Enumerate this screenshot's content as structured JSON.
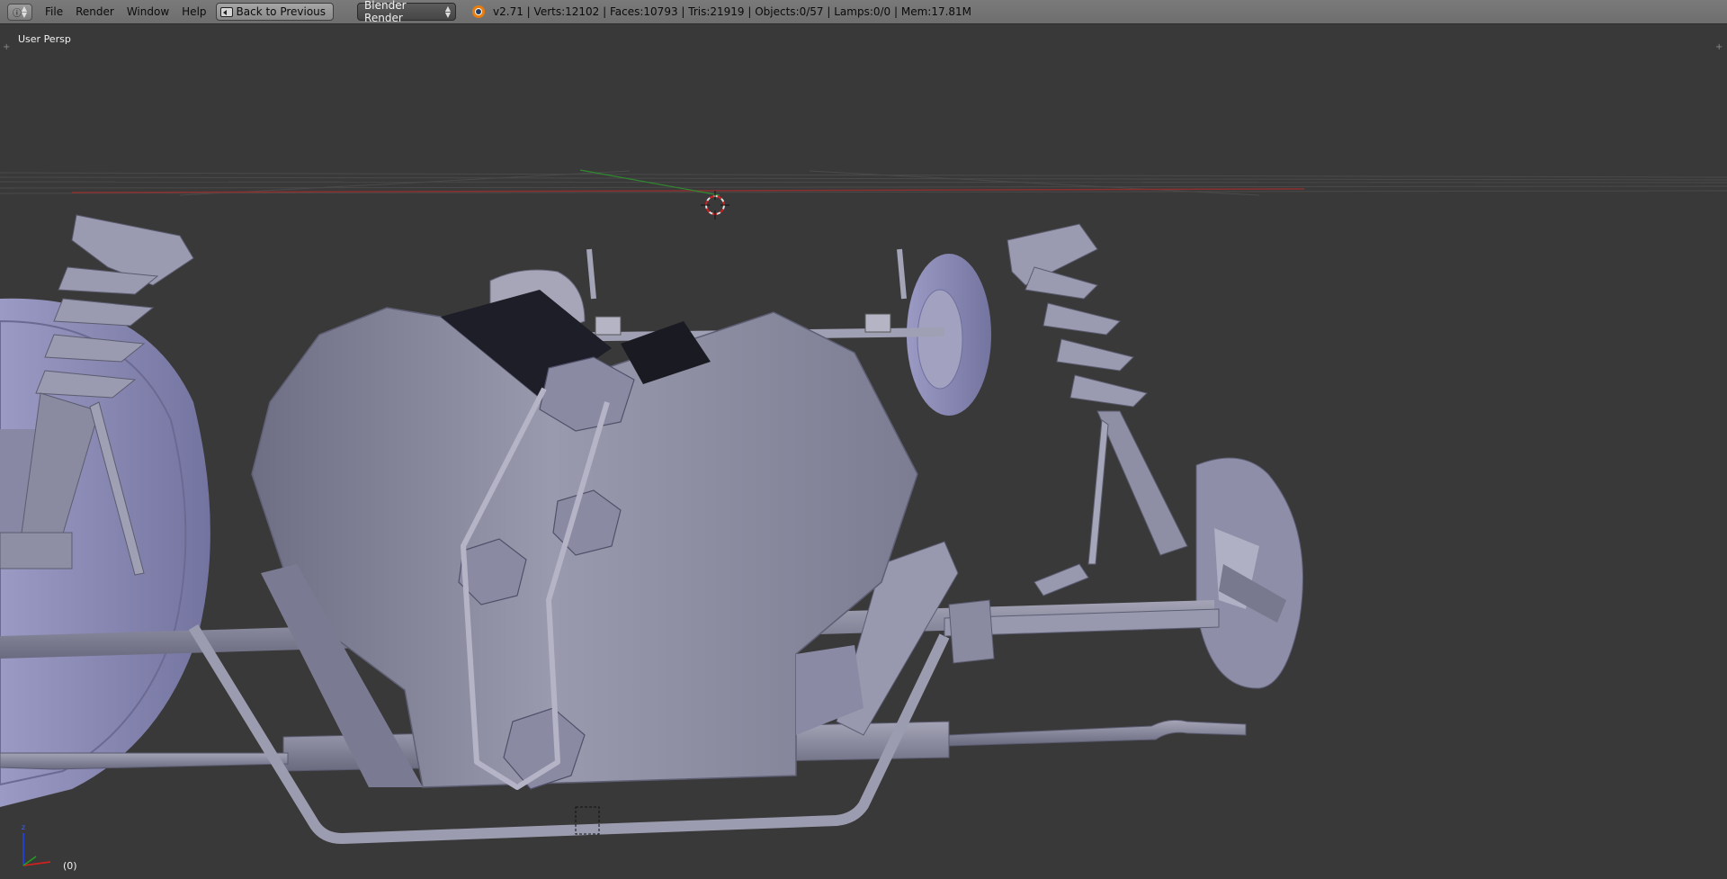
{
  "header": {
    "editor_type_icon": "info-icon",
    "menu": [
      "File",
      "Render",
      "Window",
      "Help"
    ],
    "back_button": "Back to Previous",
    "render_engine": "Blender Render",
    "stats": "v2.71 | Verts:12102 | Faces:10793 | Tris:21919 | Objects:0/57 | Lamps:0/0 | Mem:17.81M"
  },
  "viewport": {
    "view_name": "User Persp",
    "frame": "(0)"
  },
  "colors": {
    "header_bg": "#727272",
    "viewport_bg": "#393939",
    "mesh": "#8c8ca2",
    "x_axis": "#d02020",
    "y_axis": "#20a020",
    "z_axis": "#2040e0"
  }
}
